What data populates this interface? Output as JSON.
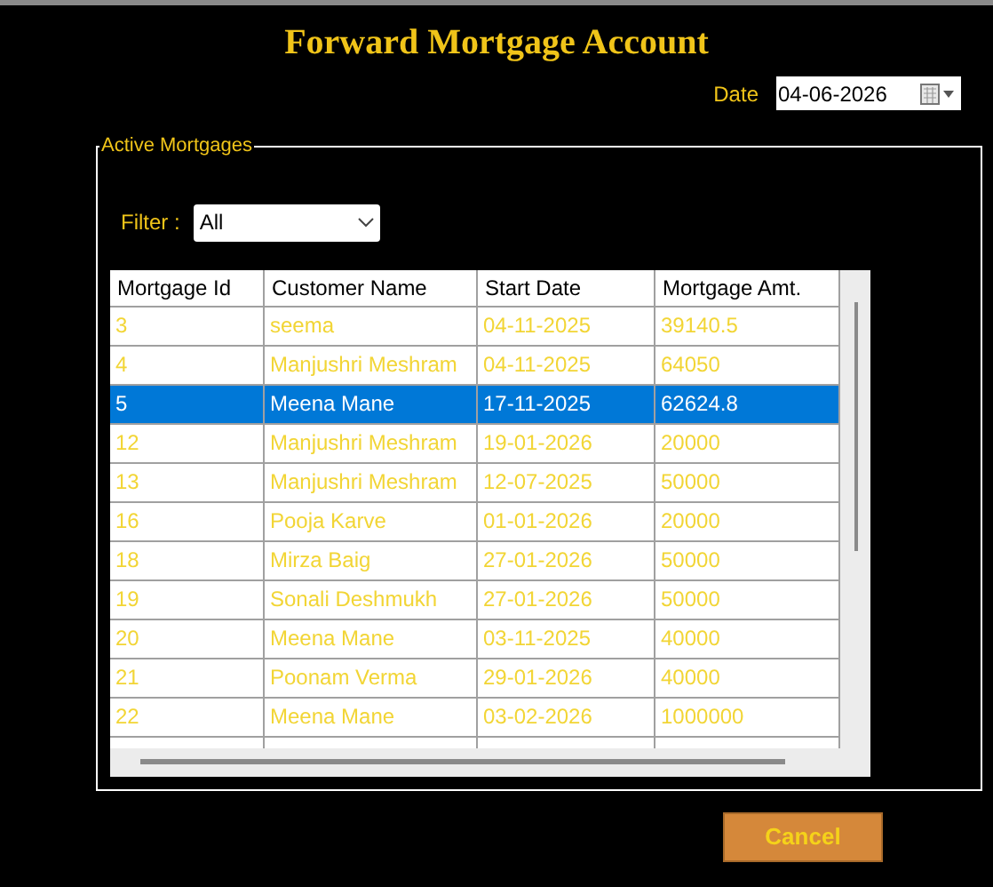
{
  "title": "Forward Mortgage Account",
  "date": {
    "label": "Date",
    "value": "04-06-2026"
  },
  "group": {
    "title": "Active Mortgages",
    "filter": {
      "label": "Filter :",
      "value": "All"
    },
    "table": {
      "columns": [
        "Mortgage Id",
        "Customer Name",
        "Start Date",
        "Mortgage Amt."
      ],
      "rows": [
        {
          "cells": [
            "3",
            "seema",
            "04-11-2025",
            "39140.5"
          ],
          "selected": false
        },
        {
          "cells": [
            "4",
            "Manjushri Meshram",
            "04-11-2025",
            "64050"
          ],
          "selected": false
        },
        {
          "cells": [
            "5",
            "Meena Mane",
            "17-11-2025",
            "62624.8"
          ],
          "selected": true
        },
        {
          "cells": [
            "12",
            "Manjushri Meshram",
            "19-01-2026",
            "20000"
          ],
          "selected": false
        },
        {
          "cells": [
            "13",
            "Manjushri Meshram",
            "12-07-2025",
            "50000"
          ],
          "selected": false
        },
        {
          "cells": [
            "16",
            "Pooja Karve",
            "01-01-2026",
            "20000"
          ],
          "selected": false
        },
        {
          "cells": [
            "18",
            "Mirza Baig",
            "27-01-2026",
            "50000"
          ],
          "selected": false
        },
        {
          "cells": [
            "19",
            "Sonali Deshmukh",
            "27-01-2026",
            "50000"
          ],
          "selected": false
        },
        {
          "cells": [
            "20",
            "Meena Mane",
            "03-11-2025",
            "40000"
          ],
          "selected": false
        },
        {
          "cells": [
            "21",
            "Poonam Verma",
            "29-01-2026",
            "40000"
          ],
          "selected": false
        },
        {
          "cells": [
            "22",
            "Meena Mane",
            "03-02-2026",
            "1000000"
          ],
          "selected": false
        }
      ]
    }
  },
  "buttons": [
    "Cancel"
  ]
}
